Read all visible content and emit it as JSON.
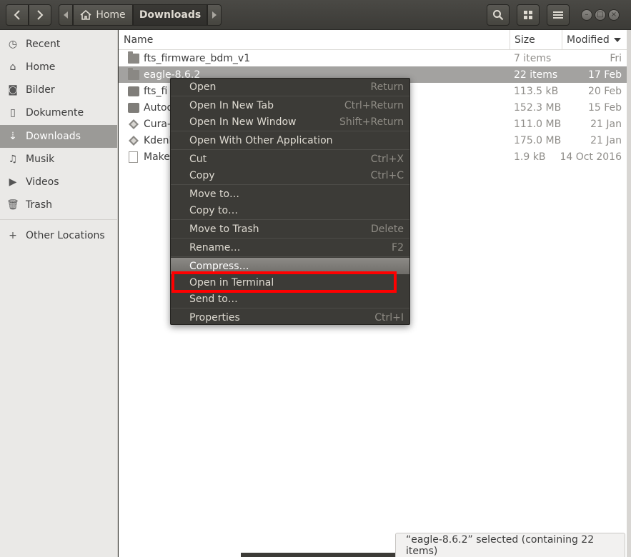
{
  "header": {
    "path_home": "Home",
    "path_current": "Downloads"
  },
  "sidebar": {
    "items": [
      {
        "label": "Recent",
        "icon": "clock-icon",
        "glyph": "◷"
      },
      {
        "label": "Home",
        "icon": "home-icon",
        "glyph": "⌂"
      },
      {
        "label": "Bilder",
        "icon": "camera-icon",
        "glyph": "◙"
      },
      {
        "label": "Dokumente",
        "icon": "document-icon",
        "glyph": "▯"
      },
      {
        "label": "Downloads",
        "icon": "download-icon",
        "glyph": "⇣",
        "active": true
      },
      {
        "label": "Musik",
        "icon": "music-icon",
        "glyph": "♫"
      },
      {
        "label": "Videos",
        "icon": "video-icon",
        "glyph": "▶"
      },
      {
        "label": "Trash",
        "icon": "trash-icon",
        "glyph": "🗑"
      }
    ],
    "other_locations": {
      "label": "Other Locations",
      "icon": "plus-icon",
      "glyph": "+"
    }
  },
  "columns": {
    "name": "Name",
    "size": "Size",
    "modified": "Modified"
  },
  "files": [
    {
      "name": "fts_firmware_bdm_v1",
      "size": "7 items",
      "date": "Fri",
      "type": "folder"
    },
    {
      "name": "eagle-8.6.2",
      "size": "22 items",
      "date": "17 Feb",
      "type": "folder",
      "selected": true
    },
    {
      "name": "fts_fi",
      "size": "113.5 kB",
      "date": "20 Feb",
      "type": "archive"
    },
    {
      "name": "Autod",
      "size": "152.3 MB",
      "date": "15 Feb",
      "type": "archive"
    },
    {
      "name": "Cura-",
      "size": "111.0 MB",
      "date": "21 Jan",
      "type": "diamond"
    },
    {
      "name": "Kdenl",
      "size": "175.0 MB",
      "date": "21 Jan",
      "type": "diamond"
    },
    {
      "name": "Make",
      "size": "1.9 kB",
      "date": "14 Oct 2016",
      "type": "doc"
    }
  ],
  "context_menu": [
    {
      "label": "Open",
      "accel": "Return"
    },
    {
      "label": "Open In New Tab",
      "accel": "Ctrl+Return"
    },
    {
      "label": "Open In New Window",
      "accel": "Shift+Return"
    },
    {
      "label": "Open With Other Application",
      "accel": ""
    },
    {
      "label": "Cut",
      "accel": "Ctrl+X"
    },
    {
      "label": "Copy",
      "accel": "Ctrl+C"
    },
    {
      "label": "Move to…",
      "accel": ""
    },
    {
      "label": "Copy to…",
      "accel": ""
    },
    {
      "label": "Move to Trash",
      "accel": "Delete"
    },
    {
      "label": "Rename…",
      "accel": "F2"
    },
    {
      "label": "Compress…",
      "accel": ""
    },
    {
      "label": "Open in Terminal",
      "accel": ""
    },
    {
      "label": "Send to…",
      "accel": ""
    },
    {
      "label": "Properties",
      "accel": "Ctrl+I"
    }
  ],
  "status": "“eagle-8.6.2” selected  (containing 22 items)",
  "colors": {
    "highlight": "#ff0000",
    "selection": "#a3a2a0"
  }
}
